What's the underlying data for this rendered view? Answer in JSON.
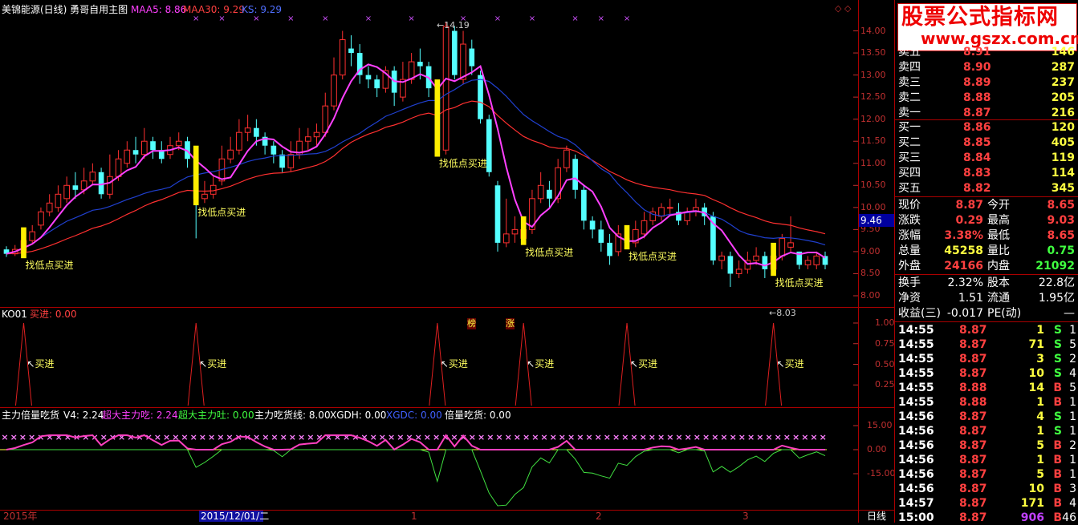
{
  "header": {
    "title": "美锦能源(日线) 勇哥自用主图",
    "ma5_label": "MAA5: 8.86",
    "ma30_label": "MAA30: 9.29",
    "ks_label": "KS: 9.29",
    "colors": {
      "title": "#ffffff",
      "ma5": "#ff40ff",
      "ma30": "#ff4040",
      "ks": "#4060ff"
    }
  },
  "main_chart": {
    "price_ticks": [
      "14.00",
      "13.50",
      "13.00",
      "12.50",
      "12.00",
      "11.50",
      "11.00",
      "10.50",
      "10.00",
      "9.50",
      "9.00",
      "8.50",
      "8.00"
    ],
    "price_range": [
      7.8,
      14.3
    ],
    "current_price_tag": "9.46",
    "high_marker": "14.19",
    "low_marker": "8.03",
    "buy_signal_text": "找低点买进",
    "flags": [
      "榜",
      "涨"
    ],
    "ma5_color": "#ff40ff",
    "ma_mid_color": "#ff3030",
    "ks_color": "#2040d0"
  },
  "candles": [
    [
      9.05,
      8.95,
      9.12,
      8.88
    ],
    [
      8.95,
      9.05,
      9.15,
      8.9
    ],
    [
      9.0,
      9.25,
      9.3,
      8.95
    ],
    [
      9.25,
      9.45,
      9.6,
      9.2
    ],
    [
      9.6,
      9.9,
      10.0,
      9.5
    ],
    [
      9.9,
      10.1,
      10.3,
      9.8
    ],
    [
      10.0,
      10.3,
      10.5,
      9.9
    ],
    [
      10.2,
      10.5,
      10.7,
      10.1
    ],
    [
      10.5,
      10.4,
      10.8,
      10.2
    ],
    [
      10.4,
      10.6,
      10.9,
      10.3
    ],
    [
      10.6,
      10.8,
      11.0,
      10.5
    ],
    [
      10.8,
      10.3,
      10.9,
      10.2
    ],
    [
      10.3,
      10.7,
      11.2,
      10.2
    ],
    [
      10.7,
      11.1,
      11.3,
      10.6
    ],
    [
      11.0,
      11.3,
      11.5,
      10.9
    ],
    [
      11.3,
      11.2,
      11.6,
      11.0
    ],
    [
      11.2,
      11.5,
      11.8,
      11.1
    ],
    [
      11.5,
      11.3,
      11.6,
      11.1
    ],
    [
      11.3,
      11.1,
      11.5,
      11.0
    ],
    [
      11.2,
      11.4,
      11.6,
      11.1
    ],
    [
      11.4,
      11.5,
      11.7,
      11.3
    ],
    [
      11.5,
      11.1,
      11.6,
      10.9
    ],
    [
      11.1,
      10.2,
      11.2,
      9.3
    ],
    [
      10.2,
      10.3,
      10.6,
      10.1
    ],
    [
      10.3,
      10.5,
      10.7,
      10.2
    ],
    [
      10.6,
      11.1,
      11.4,
      10.5
    ],
    [
      11.1,
      11.3,
      11.6,
      11.0
    ],
    [
      11.3,
      11.7,
      12.0,
      11.2
    ],
    [
      11.7,
      11.8,
      12.1,
      11.5
    ],
    [
      11.8,
      11.6,
      12.0,
      11.4
    ],
    [
      11.6,
      11.4,
      11.7,
      11.2
    ],
    [
      11.4,
      11.2,
      11.5,
      11.0
    ],
    [
      11.2,
      10.9,
      11.3,
      10.8
    ],
    [
      10.9,
      11.2,
      11.5,
      10.8
    ],
    [
      11.2,
      11.5,
      11.8,
      11.1
    ],
    [
      11.5,
      11.6,
      11.8,
      11.3
    ],
    [
      11.6,
      11.7,
      11.9,
      11.4
    ],
    [
      11.7,
      12.3,
      12.6,
      11.6
    ],
    [
      12.3,
      13.0,
      13.4,
      12.2
    ],
    [
      13.0,
      13.8,
      14.0,
      12.9
    ],
    [
      13.6,
      13.5,
      13.9,
      13.2
    ],
    [
      13.5,
      13.0,
      13.7,
      12.8
    ],
    [
      13.0,
      12.9,
      13.2,
      12.7
    ],
    [
      12.9,
      12.7,
      13.0,
      12.5
    ],
    [
      12.7,
      13.1,
      13.2,
      12.6
    ],
    [
      13.1,
      12.6,
      13.2,
      12.3
    ],
    [
      12.5,
      12.9,
      13.3,
      12.4
    ],
    [
      12.9,
      13.3,
      13.5,
      12.8
    ],
    [
      13.3,
      13.2,
      13.6,
      12.9
    ],
    [
      13.2,
      12.7,
      13.3,
      12.5
    ],
    [
      12.6,
      11.3,
      12.7,
      11.2
    ],
    [
      11.3,
      14.1,
      14.19,
      11.2
    ],
    [
      14.0,
      13.0,
      14.1,
      12.9
    ],
    [
      12.9,
      13.7,
      14.0,
      12.8
    ],
    [
      13.6,
      13.2,
      13.8,
      13.0
    ],
    [
      13.0,
      12.0,
      13.1,
      11.9
    ],
    [
      12.0,
      10.8,
      12.1,
      10.7
    ],
    [
      10.5,
      9.2,
      10.6,
      9.0
    ],
    [
      9.2,
      9.4,
      10.2,
      9.1
    ],
    [
      9.4,
      9.5,
      9.8,
      9.2
    ],
    [
      9.3,
      9.5,
      9.7,
      9.2
    ],
    [
      9.5,
      10.2,
      10.4,
      9.4
    ],
    [
      10.2,
      10.5,
      10.8,
      10.1
    ],
    [
      10.4,
      10.2,
      10.6,
      10.0
    ],
    [
      10.2,
      10.9,
      11.1,
      10.1
    ],
    [
      10.9,
      11.3,
      11.4,
      10.8
    ],
    [
      11.1,
      10.4,
      11.2,
      10.2
    ],
    [
      10.4,
      9.7,
      10.5,
      9.5
    ],
    [
      9.7,
      9.5,
      9.8,
      9.3
    ],
    [
      9.5,
      9.2,
      9.7,
      9.0
    ],
    [
      9.2,
      8.9,
      9.4,
      8.7
    ],
    [
      9.0,
      9.4,
      9.6,
      8.9
    ],
    [
      9.3,
      9.2,
      9.5,
      9.1
    ],
    [
      9.2,
      9.5,
      9.7,
      9.1
    ],
    [
      9.4,
      9.7,
      9.9,
      9.3
    ],
    [
      9.7,
      9.9,
      10.0,
      9.6
    ],
    [
      9.8,
      10.0,
      10.1,
      9.7
    ],
    [
      10.0,
      10.0,
      10.2,
      9.8
    ],
    [
      9.9,
      9.7,
      10.1,
      9.6
    ],
    [
      9.7,
      9.9,
      10.0,
      9.6
    ],
    [
      9.9,
      10.0,
      10.2,
      9.8
    ],
    [
      10.0,
      9.8,
      10.1,
      9.6
    ],
    [
      9.8,
      8.8,
      9.9,
      8.7
    ],
    [
      8.8,
      8.9,
      9.0,
      8.6
    ],
    [
      8.9,
      8.5,
      9.0,
      8.2
    ],
    [
      8.5,
      8.6,
      8.8,
      8.4
    ],
    [
      8.6,
      8.8,
      9.0,
      8.5
    ],
    [
      8.8,
      8.9,
      9.1,
      8.7
    ],
    [
      8.9,
      8.6,
      9.0,
      8.4
    ],
    [
      8.6,
      8.9,
      9.1,
      8.5
    ],
    [
      8.9,
      9.3,
      9.4,
      8.8
    ],
    [
      9.1,
      9.2,
      9.8,
      9.0
    ],
    [
      9.0,
      8.7,
      9.0,
      8.6
    ],
    [
      8.7,
      8.8,
      8.9,
      8.6
    ],
    [
      8.7,
      8.9,
      9.0,
      8.6
    ],
    [
      8.9,
      8.7,
      9.0,
      8.6
    ]
  ],
  "signals_main": [
    2,
    22,
    50,
    60,
    72,
    89
  ],
  "ko_panel": {
    "title": "KO01",
    "buy_label": "买进: 0.00",
    "ticks": [
      "1.00",
      "0.75",
      "0.50",
      "0.25"
    ],
    "spike_text": "买进"
  },
  "bottom_panel": {
    "title": "主力倍量吃货",
    "v4": "V4: 2.24",
    "super_eat": "超大主力吃: 2.24",
    "super_spit": "超大主力吐: 0.00",
    "main_line": "主力吃货线: 8.00",
    "xgdh": "XGDH: 0.00",
    "xgdc": "XGDC: 0.00",
    "double_vol": "倍量吃货: 0.00",
    "ticks": [
      "15.00",
      "0.00",
      "-15.00"
    ]
  },
  "time_axis": {
    "labels": [
      "2015年",
      "2015/12/01/二",
      "1",
      "2",
      "3"
    ],
    "period": "日线"
  },
  "logo": {
    "line1": "股票公式指标网",
    "line2": "www.gszx.com.cn"
  },
  "order_book": {
    "sells": [
      {
        "label": "卖五",
        "price": "8.91",
        "vol": "146"
      },
      {
        "label": "卖四",
        "price": "8.90",
        "vol": "287"
      },
      {
        "label": "卖三",
        "price": "8.89",
        "vol": "237"
      },
      {
        "label": "卖二",
        "price": "8.88",
        "vol": "205"
      },
      {
        "label": "卖一",
        "price": "8.87",
        "vol": "216"
      }
    ],
    "buys": [
      {
        "label": "买一",
        "price": "8.86",
        "vol": "120"
      },
      {
        "label": "买二",
        "price": "8.85",
        "vol": "405"
      },
      {
        "label": "买三",
        "price": "8.84",
        "vol": "119"
      },
      {
        "label": "买四",
        "price": "8.83",
        "vol": "114"
      },
      {
        "label": "买五",
        "price": "8.82",
        "vol": "345"
      }
    ]
  },
  "quote": [
    {
      "l1": "现价",
      "v1": "8.87",
      "c1": "#ff4040",
      "l2": "今开",
      "v2": "8.65",
      "c2": "#ff4040"
    },
    {
      "l1": "涨跌",
      "v1": "0.29",
      "c1": "#ff4040",
      "l2": "最高",
      "v2": "9.03",
      "c2": "#ff4040"
    },
    {
      "l1": "涨幅",
      "v1": "3.38%",
      "c1": "#ff4040",
      "l2": "最低",
      "v2": "8.65",
      "c2": "#ff4040"
    },
    {
      "l1": "总量",
      "v1": "45258",
      "c1": "#ffff40",
      "l2": "量比",
      "v2": "0.75",
      "c2": "#40ff40"
    },
    {
      "l1": "外盘",
      "v1": "24166",
      "c1": "#ff4040",
      "l2": "内盘",
      "v2": "21092",
      "c2": "#40ff40"
    }
  ],
  "fundamentals": [
    {
      "l1": "换手",
      "v1": "2.32%",
      "l2": "股本",
      "v2": "22.8亿"
    },
    {
      "l1": "净资",
      "v1": "1.51",
      "l2": "流通",
      "v2": "1.95亿"
    },
    {
      "l1": "收益(三)",
      "v1": "-0.017",
      "l2": "PE(动)",
      "v2": "—"
    }
  ],
  "ticks_list": [
    {
      "time": "14:55",
      "price": "8.87",
      "vol": "1",
      "side": "S",
      "n": "1"
    },
    {
      "time": "14:55",
      "price": "8.87",
      "vol": "71",
      "side": "S",
      "n": "5"
    },
    {
      "time": "14:55",
      "price": "8.87",
      "vol": "3",
      "side": "S",
      "n": "2"
    },
    {
      "time": "14:55",
      "price": "8.87",
      "vol": "10",
      "side": "S",
      "n": "4"
    },
    {
      "time": "14:55",
      "price": "8.88",
      "vol": "14",
      "side": "B",
      "n": "5"
    },
    {
      "time": "14:55",
      "price": "8.88",
      "vol": "1",
      "side": "B",
      "n": "1"
    },
    {
      "time": "14:56",
      "price": "8.87",
      "vol": "4",
      "side": "S",
      "n": "1"
    },
    {
      "time": "14:56",
      "price": "8.87",
      "vol": "1",
      "side": "S",
      "n": "1"
    },
    {
      "time": "14:56",
      "price": "8.87",
      "vol": "5",
      "side": "B",
      "n": "2"
    },
    {
      "time": "14:56",
      "price": "8.87",
      "vol": "1",
      "side": "B",
      "n": "1"
    },
    {
      "time": "14:56",
      "price": "8.87",
      "vol": "5",
      "side": "B",
      "n": "1"
    },
    {
      "time": "14:56",
      "price": "8.87",
      "vol": "10",
      "side": "B",
      "n": "3"
    },
    {
      "time": "14:57",
      "price": "8.87",
      "vol": "171",
      "side": "B",
      "n": "4"
    },
    {
      "time": "15:00",
      "price": "8.87",
      "vol": "906",
      "side": "B",
      "n": "46"
    }
  ]
}
